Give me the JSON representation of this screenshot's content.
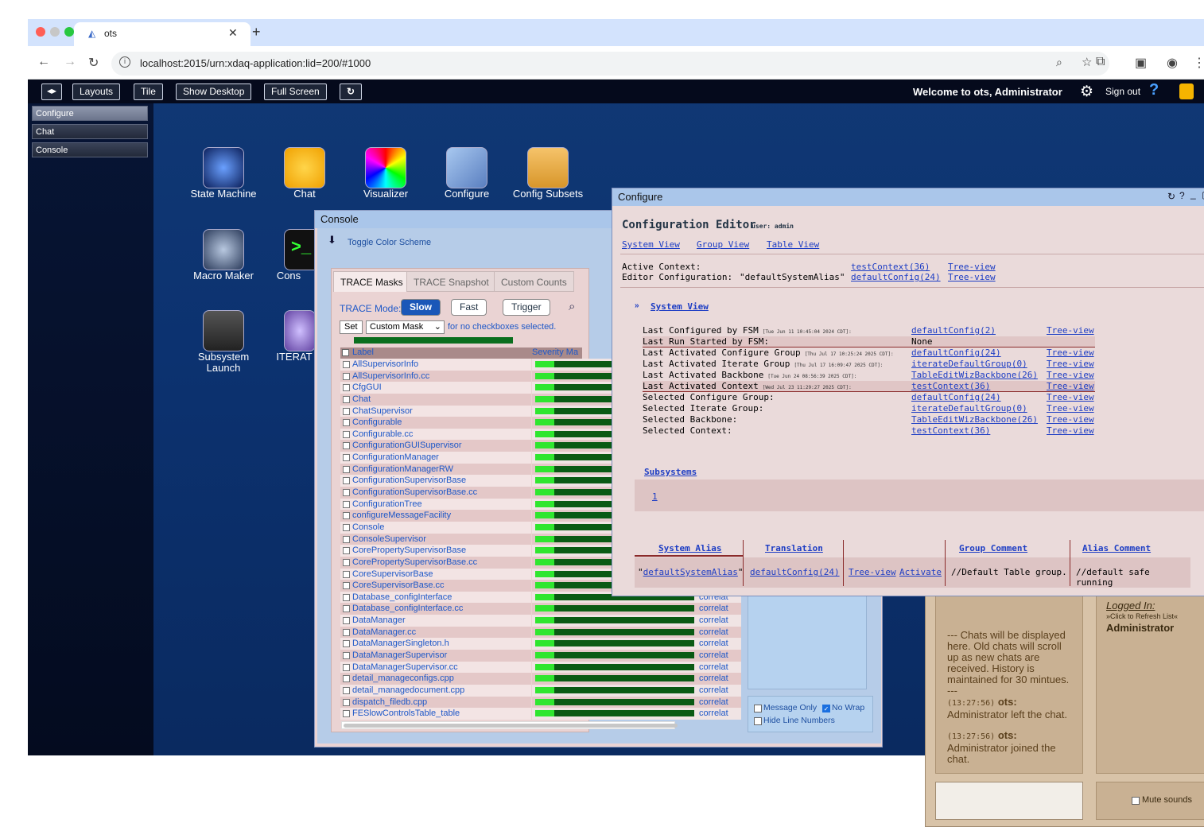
{
  "browser": {
    "tab_title": "ots",
    "url": "localhost:2015/urn:xdaq-application:lid=200/#1000"
  },
  "topbar": {
    "layouts": "Layouts",
    "tile": "Tile",
    "show_desktop": "Show Desktop",
    "full_screen": "Full Screen",
    "welcome": "Welcome to ots, Administrator",
    "sign_out": "Sign out"
  },
  "sidebar": {
    "items": [
      {
        "label": "Configure"
      },
      {
        "label": "Chat"
      },
      {
        "label": "Console"
      }
    ]
  },
  "desktop": {
    "icons": [
      {
        "label": "State Machine"
      },
      {
        "label": "Chat"
      },
      {
        "label": "Visualizer"
      },
      {
        "label": "Configure"
      },
      {
        "label": "Config Subsets"
      },
      {
        "label": "Macro Maker"
      },
      {
        "label": "Cons"
      },
      {
        "label": "Subsystem Launch"
      },
      {
        "label": "ITERAT"
      }
    ]
  },
  "console": {
    "title": "Console",
    "toggle": "Toggle Color Scheme",
    "tabs": [
      {
        "label": "TRACE Masks"
      },
      {
        "label": "TRACE Snapshot"
      },
      {
        "label": "Custom Counts"
      }
    ],
    "trace_mode_label": "TRACE Mode:",
    "modes": [
      {
        "label": "Slow"
      },
      {
        "label": "Fast"
      },
      {
        "label": "Trigger"
      }
    ],
    "set": "Set",
    "mask_select": "Custom Mask",
    "mask_note": "for no checkboxes selected.",
    "col_label": "Label",
    "col_severity": "Severity Ma",
    "labels": [
      "AllSupervisorInfo",
      "AllSupervisorInfo.cc",
      "CfgGUI",
      "Chat",
      "ChatSupervisor",
      "Configurable",
      "Configurable.cc",
      "ConfigurationGUISupervisor",
      "ConfigurationManager",
      "ConfigurationManagerRW",
      "ConfigurationSupervisorBase",
      "ConfigurationSupervisorBase.cc",
      "ConfigurationTree",
      "configureMessageFacility",
      "Console",
      "ConsoleSupervisor",
      "CorePropertySupervisorBase",
      "CorePropertySupervisorBase.cc",
      "CoreSupervisorBase",
      "CoreSupervisorBase.cc",
      "Database_configInterface",
      "Database_configInterface.cc",
      "DataManager",
      "DataManager.cc",
      "DataManagerSingleton.h",
      "DataManagerSupervisor",
      "DataManagerSupervisor.cc",
      "detail_manageconfigs.cpp",
      "detail_managedocument.cpp",
      "dispatch_filedb.cpp",
      "FESlowControlsTable_table"
    ],
    "correlate": "correlat",
    "message_only": "Message Only",
    "no_wrap": "No Wrap",
    "hide_line_numbers": "Hide Line Numbers"
  },
  "chat": {
    "logged_in": "Logged In:",
    "refresh": "»Click to Refresh List«",
    "user": "Administrator",
    "info": "--- Chats will be displayed here. Old chats will scroll up as new chats are received. History is maintained for 30 mintues. ---",
    "messages": [
      {
        "time": "(13:27:56)",
        "who": "ots:",
        "text": "Administrator left the chat."
      },
      {
        "time": "(13:27:56)",
        "who": "ots:",
        "text": "Administrator joined the chat."
      }
    ],
    "mute": "Mute sounds"
  },
  "configure": {
    "title": "Configure",
    "editor_title": "Configuration Editor",
    "user": "user: admin",
    "nav": [
      "System View",
      "Group View",
      "Table View"
    ],
    "active_context_label": "Active Context:",
    "active_context": "testContext(36)",
    "editor_cfg_label": "Editor Configuration:",
    "editor_alias": "\"defaultSystemAlias\"",
    "editor_cfg": "defaultConfig(24)",
    "tree_view": "Tree-view",
    "section": "System View",
    "state_rows": [
      {
        "label": "Last Configured by FSM",
        "date": "[Tue Jun 11 10:45:04 2024 CDT]:",
        "value": "defaultConfig(2)",
        "tree": "Tree-view"
      },
      {
        "label": "Last Run Started by FSM:",
        "date": "",
        "value": "None",
        "tree": ""
      },
      {
        "label": "Last Activated Configure Group",
        "date": "[Thu Jul 17 10:25:24 2025 CDT]:",
        "value": "defaultConfig(24)",
        "tree": "Tree-view"
      },
      {
        "label": "Last Activated Iterate Group",
        "date": "[Thu Jul 17 16:09:47 2025 CDT]:",
        "value": "iterateDefaultGroup(0)",
        "tree": "Tree-view"
      },
      {
        "label": "Last Activated Backbone",
        "date": "[Tue Jun 24 08:56:39 2025 CDT]:",
        "value": "TableEditWizBackbone(26)",
        "tree": "Tree-view"
      },
      {
        "label": "Last Activated Context",
        "date": "[Wed Jul 23 11:29:27 2025 CDT]:",
        "value": "testContext(36)",
        "tree": "Tree-view"
      },
      {
        "label": "Selected Configure Group:",
        "date": "",
        "value": "defaultConfig(24)",
        "tree": "Tree-view"
      },
      {
        "label": "Selected Iterate Group:",
        "date": "",
        "value": "iterateDefaultGroup(0)",
        "tree": "Tree-view"
      },
      {
        "label": "Selected Backbone:",
        "date": "",
        "value": "TableEditWizBackbone(26)",
        "tree": "Tree-view"
      },
      {
        "label": "Selected Context:",
        "date": "",
        "value": "testContext(36)",
        "tree": "Tree-view"
      }
    ],
    "subsystems": "Subsystems",
    "subsystem_item": "1",
    "table_headers": [
      "System Alias",
      "Translation",
      "Group Comment",
      "Alias Comment"
    ],
    "alias_row": {
      "alias": "defaultSystemAlias",
      "translation": "defaultConfig(24)",
      "tree": "Tree-view",
      "activate": "Activate",
      "group_comment": "//Default Table group.",
      "alias_comment": "//default safe running"
    }
  }
}
